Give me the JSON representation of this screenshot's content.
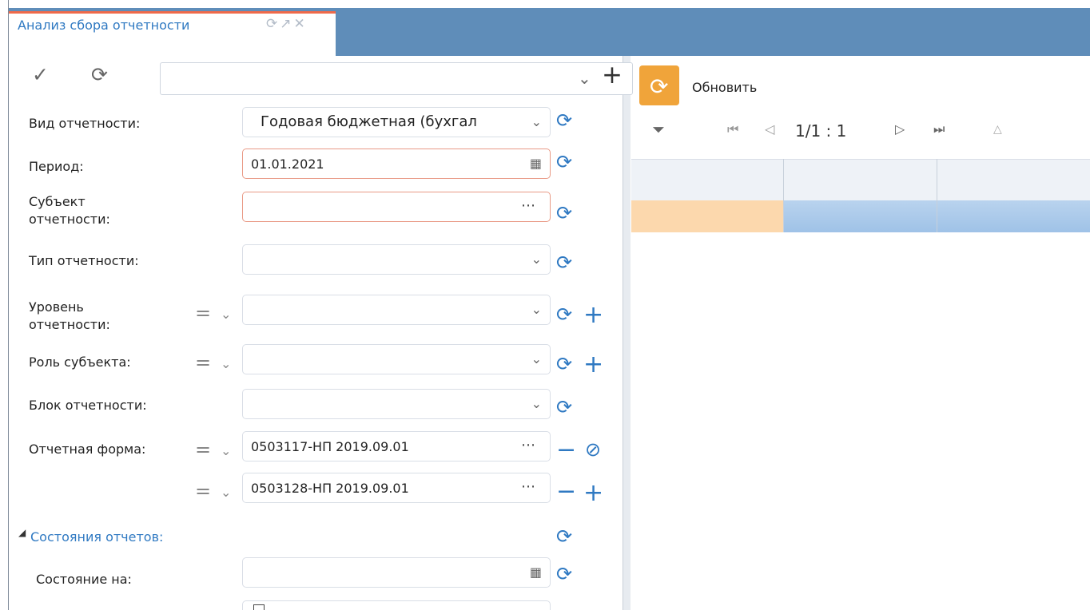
{
  "tab": {
    "title": "Анализ сбора отчетности",
    "icons": [
      "refresh-icon",
      "expand-icon",
      "close-icon"
    ]
  },
  "left_toolbar": {
    "icons": [
      "check-icon",
      "refresh-icon"
    ],
    "command_value": ""
  },
  "form": {
    "vid_otchetnosti": {
      "label": "Вид отчетности:",
      "value": "Годовая бюджетная (бухгал"
    },
    "period": {
      "label": "Период:",
      "value": "01.01.2021"
    },
    "subekt": {
      "label": "Субъект\nотчетности:",
      "value": ""
    },
    "tip": {
      "label": "Тип отчетности:",
      "value": ""
    },
    "uroven": {
      "label": "Уровень\nотчетности:",
      "value": ""
    },
    "rol": {
      "label": "Роль субъекта:",
      "value": ""
    },
    "blok": {
      "label": "Блок отчетности:",
      "value": ""
    },
    "otchetnaya_forma": {
      "label": "Отчетная форма:",
      "value_1": "0503117-НП 2019.09.01",
      "value_2": "0503128-НП 2019.09.01"
    },
    "section": {
      "title": "Состояния отчетов:"
    },
    "sostoyanie": {
      "label": "Состояние на:",
      "value": ""
    }
  },
  "right_panel": {
    "refresh_label": "Обновить",
    "pager": {
      "page_text": "1/1 : 1"
    },
    "grid": {
      "columns": 3,
      "selected_row_colors": [
        "#fcd8ad",
        "#9fc2e7",
        "#9fc2e7"
      ]
    }
  },
  "colors": {
    "accent": "#2f79c2",
    "tab_bar": "#5f8db9",
    "orange": "#f0a43a",
    "error_border": "#e99a86"
  }
}
